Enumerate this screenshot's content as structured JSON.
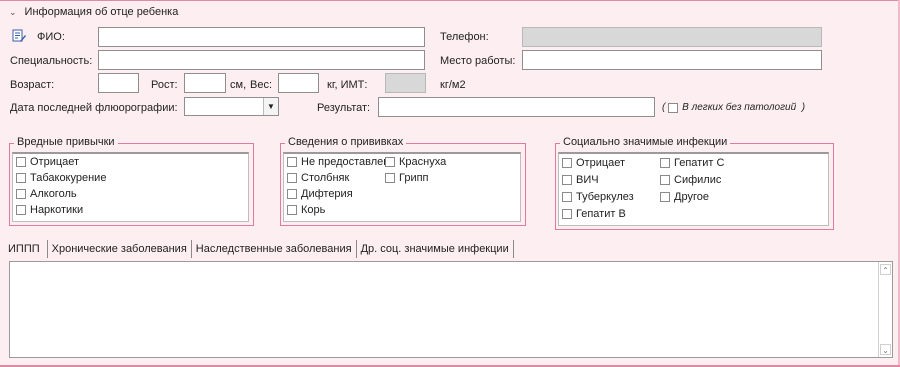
{
  "section": {
    "title": "Информация об отце ребенка"
  },
  "fields": {
    "fio": {
      "label": "ФИО:",
      "value": ""
    },
    "phone": {
      "label": "Телефон:",
      "value": ""
    },
    "specialty": {
      "label": "Специальность:",
      "value": ""
    },
    "workplace": {
      "label": "Место работы:",
      "value": ""
    },
    "age": {
      "label": "Возраст:",
      "value": ""
    },
    "height": {
      "label": "Рост:",
      "value": "",
      "unit": "см,"
    },
    "weight": {
      "label": "Вес:",
      "value": "",
      "unit": "кг, ИМТ:"
    },
    "bmi": {
      "value": "",
      "unit": "кг/м2"
    },
    "fluoro_date": {
      "label": "Дата последней флюорографии:",
      "value": ""
    },
    "result": {
      "label": "Результат:",
      "value": ""
    },
    "lungs_normal": {
      "prefix": "(",
      "label": "В легких без патологий",
      "suffix": ")",
      "checked": false
    }
  },
  "groups": {
    "habits": {
      "title": "Вредные привычки",
      "items": [
        "Отрицает",
        "Табакокурение",
        "Алкоголь",
        "Наркотики"
      ]
    },
    "vaccines": {
      "title": "Сведения о прививках",
      "items": [
        "Не предоставлен",
        "Столбняк",
        "Дифтерия",
        "Корь",
        "Краснуха",
        "Грипп"
      ]
    },
    "infections": {
      "title": "Социально значимые инфекции",
      "items": [
        "Отрицает",
        "ВИЧ",
        "Туберкулез",
        "Гепатит B",
        "Гепатит C",
        "Сифилис",
        "Другое"
      ]
    }
  },
  "tabs": [
    "ИППП",
    "Хронические заболевания",
    "Наследственные заболевания",
    "Др. соц. значимые инфекции"
  ],
  "tab_content": "",
  "colors": {
    "background": "#fdeef2",
    "group_border": "#e07aa0",
    "readonly_fill": "#d8d8d8"
  }
}
